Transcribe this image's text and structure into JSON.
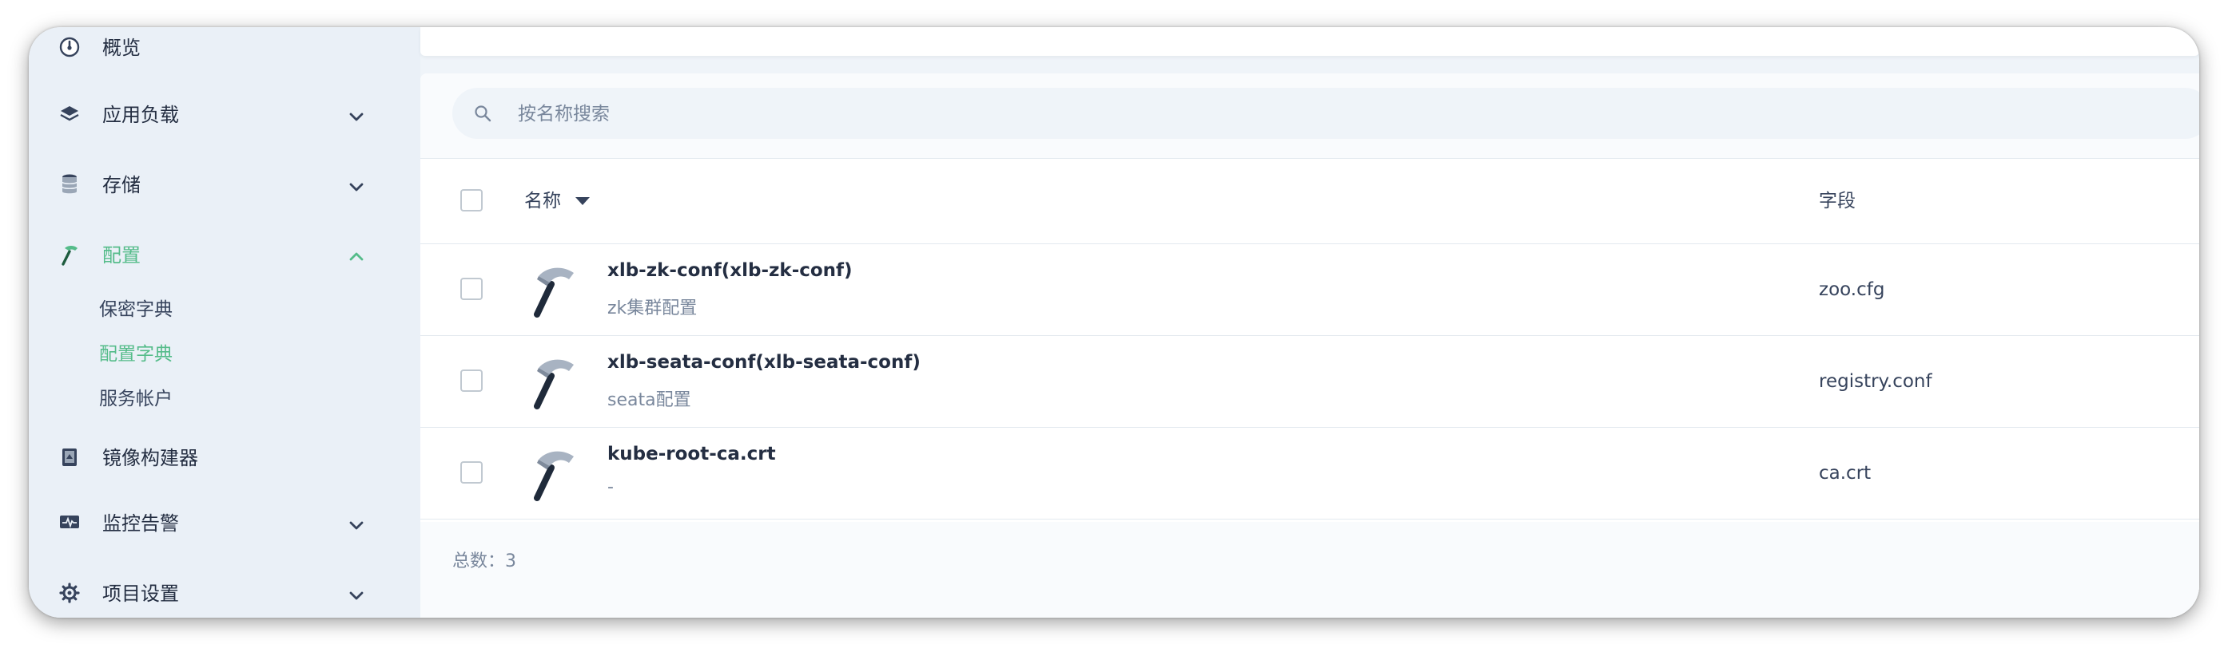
{
  "sidebar": {
    "items": [
      {
        "label": "概览",
        "icon": "dashboard-icon"
      },
      {
        "label": "应用负载",
        "icon": "layers-icon",
        "expanded": false
      },
      {
        "label": "存储",
        "icon": "database-icon",
        "expanded": false
      },
      {
        "label": "配置",
        "icon": "hammer-icon",
        "expanded": true,
        "active": true
      },
      {
        "label": "镜像构建器",
        "icon": "image-builder-icon"
      },
      {
        "label": "监控告警",
        "icon": "monitor-icon",
        "expanded": false
      },
      {
        "label": "项目设置",
        "icon": "gear-icon",
        "expanded": false
      }
    ],
    "sub_items": [
      {
        "label": "保密字典"
      },
      {
        "label": "配置字典",
        "active": true
      },
      {
        "label": "服务帐户"
      }
    ]
  },
  "search": {
    "placeholder": "按名称搜索"
  },
  "table": {
    "columns": [
      "名称",
      "字段"
    ],
    "rows": [
      {
        "name": "xlb-zk-conf(xlb-zk-conf)",
        "description": "zk集群配置",
        "field": "zoo.cfg"
      },
      {
        "name": "xlb-seata-conf(xlb-seata-conf)",
        "description": "seata配置",
        "field": "registry.conf"
      },
      {
        "name": "kube-root-ca.crt",
        "description": "-",
        "field": "ca.crt"
      }
    ],
    "total_label": "总数：3"
  },
  "colors": {
    "accent": "#55bc8a",
    "text": "#242e42",
    "muted": "#79879c",
    "sidebar_bg": "#eaf0f7"
  }
}
